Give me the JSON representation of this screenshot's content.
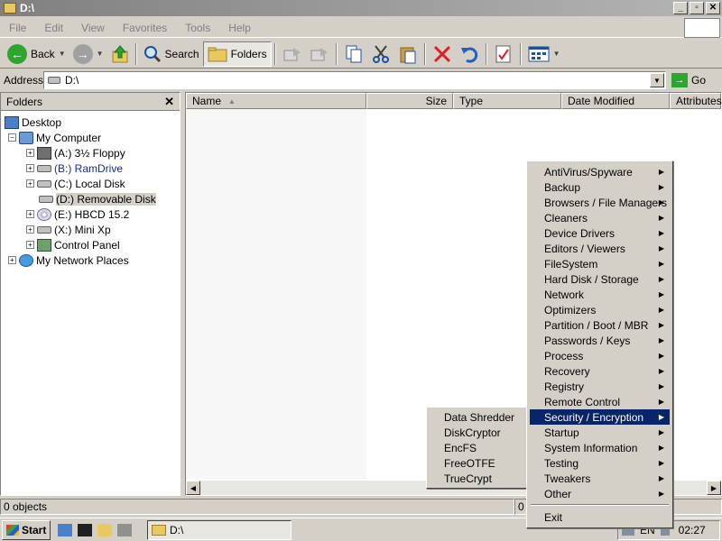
{
  "window": {
    "title": "D:\\",
    "buttons": [
      "_",
      "▫",
      "✕"
    ]
  },
  "menu": [
    "File",
    "Edit",
    "View",
    "Favorites",
    "Tools",
    "Help"
  ],
  "toolbar": {
    "back": "Back",
    "search": "Search",
    "folders": "Folders"
  },
  "address": {
    "label": "Address",
    "value": "D:\\",
    "go": "Go"
  },
  "folders": {
    "title": "Folders",
    "close": "✕",
    "tree": [
      {
        "label": "Desktop",
        "expander": ""
      },
      {
        "label": "My Computer",
        "expander": "−"
      },
      {
        "label": "(A:) 3½ Floppy",
        "expander": "+"
      },
      {
        "label": "(B:) RamDrive",
        "expander": "+"
      },
      {
        "label": "(C:) Local Disk",
        "expander": "+"
      },
      {
        "label": "(D:) Removable Disk",
        "expander": ""
      },
      {
        "label": "(E:) HBCD 15.2",
        "expander": "+"
      },
      {
        "label": "(X:) Mini Xp",
        "expander": "+"
      },
      {
        "label": "Control Panel",
        "expander": "+"
      },
      {
        "label": "My Network Places",
        "expander": "+"
      }
    ]
  },
  "columns": [
    "Name",
    "Size",
    "Type",
    "Date Modified",
    "Attributes"
  ],
  "status": {
    "objects": "0 objects",
    "second": "0"
  },
  "taskbar": {
    "start": "Start",
    "task": "D:\\",
    "lang": "EN",
    "clock": "02:27"
  },
  "context_menu": {
    "items": [
      "AntiVirus/Spyware",
      "Backup",
      "Browsers / File Managers",
      "Cleaners",
      "Device Drivers",
      "Editors / Viewers",
      "FileSystem",
      "Hard Disk / Storage",
      "Network",
      "Optimizers",
      "Partition / Boot / MBR",
      "Passwords / Keys",
      "Process",
      "Recovery",
      "Registry",
      "Remote Control",
      "Security / Encryption",
      "Startup",
      "System Information",
      "Testing",
      "Tweakers",
      "Other"
    ],
    "exit": "Exit",
    "highlighted": "Security / Encryption"
  },
  "submenu": {
    "items": [
      "Data Shredder",
      "DiskCryptor",
      "EncFS",
      "FreeOTFE",
      "TrueCrypt"
    ]
  }
}
